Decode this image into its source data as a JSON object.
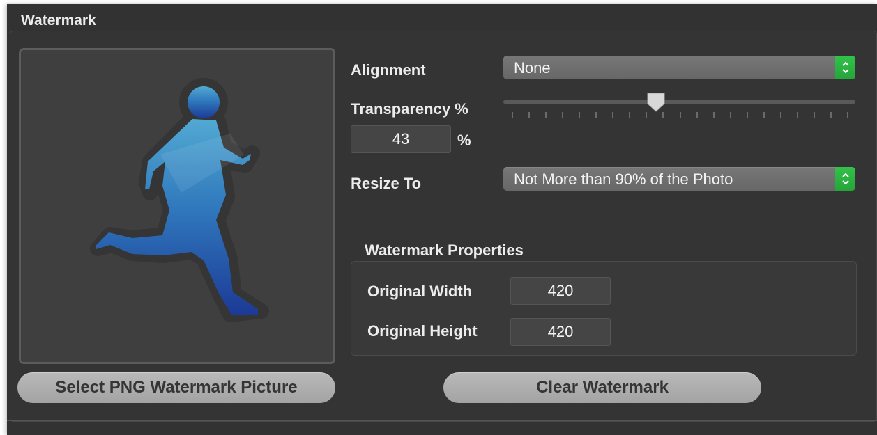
{
  "watermark": {
    "group_title": "Watermark",
    "alignment": {
      "label": "Alignment",
      "value": "None"
    },
    "transparency": {
      "label": "Transparency %",
      "value": "43",
      "unit": "%",
      "slider_fraction": 0.43
    },
    "resize": {
      "label": "Resize To",
      "value": "Not More than 90% of the Photo"
    },
    "properties": {
      "title": "Watermark Properties",
      "width_label": "Original Width",
      "width_value": "420",
      "height_label": "Original Height",
      "height_value": "420"
    },
    "buttons": {
      "select_png": "Select PNG Watermark Picture",
      "clear": "Clear Watermark"
    },
    "preview_icon": "running-man-icon"
  },
  "colors": {
    "panel_bg": "#323232",
    "stepper_green": "#2db243",
    "figure_top": "#4fa6cf",
    "figure_bottom": "#1e3f99"
  }
}
